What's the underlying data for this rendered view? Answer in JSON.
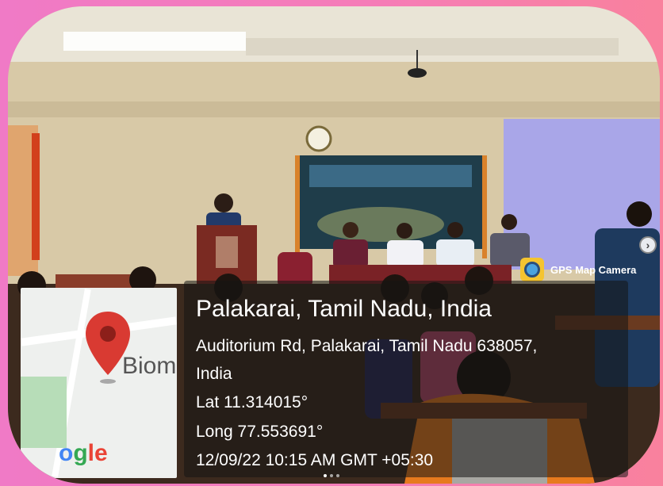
{
  "app": {
    "name": "GPS Map Camera"
  },
  "location": {
    "title": "Palakarai, Tamil Nadu, India",
    "address_line1": "Auditorium Rd, Palakarai, Tamil Nadu 638057,",
    "address_line2": "India",
    "lat": "Lat 11.314015°",
    "long": "Long 77.553691°",
    "datetime": "12/09/22 10:15 AM GMT +05:30"
  },
  "map": {
    "place_label": "Biom",
    "logo_text": "ogle",
    "pin_color": "#d93a32"
  },
  "colors": {
    "frame_pink": "#f57cb8",
    "overlay": "#141414"
  },
  "icons": {
    "next": "chevron-right-icon",
    "app": "gps-map-camera-icon",
    "pin": "map-pin-icon"
  }
}
